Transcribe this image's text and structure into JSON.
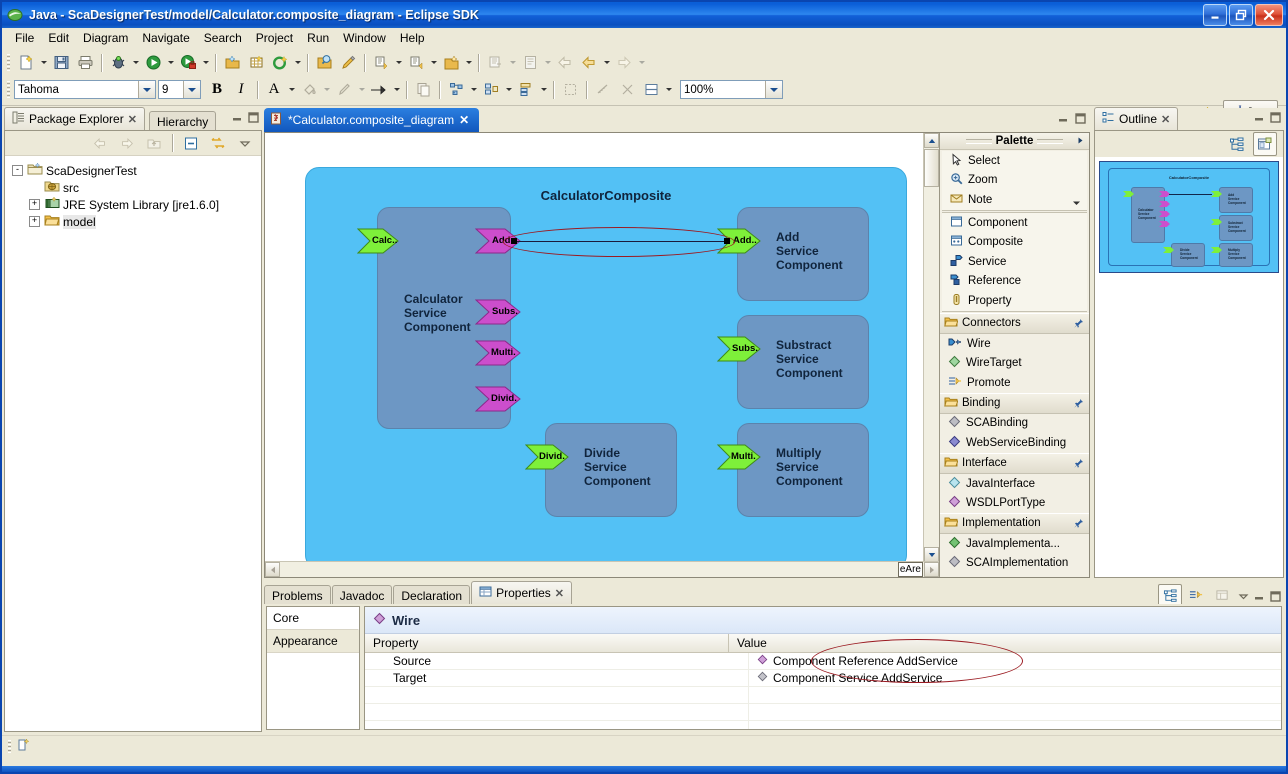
{
  "window": {
    "title": "Java - ScaDesignerTest/model/Calculator.composite_diagram - Eclipse SDK",
    "app_icon": "eclipse-icon",
    "minimize_label": "–",
    "restore_label": "❐",
    "close_label": "✕"
  },
  "menubar": {
    "items": [
      "File",
      "Edit",
      "Diagram",
      "Navigate",
      "Search",
      "Project",
      "Run",
      "Window",
      "Help"
    ]
  },
  "toolbar": {
    "font_family_value": "Tahoma",
    "font_size_value": "9",
    "bold_label": "B",
    "italic_label": "I",
    "font_color_label": "A",
    "zoom_value": "100%",
    "perspective_label": "Java",
    "perspective_icon": "java-perspective-icon",
    "open_perspective_icon": "open-perspective-icon"
  },
  "package_explorer": {
    "tab_label": "Package Explorer",
    "tab_icon": "package-explorer-icon",
    "close_label": "✕",
    "hierarchy_tab_label": "Hierarchy",
    "hierarchy_tab_icon": "hierarchy-icon",
    "toolbar": [
      "back-icon",
      "forward-icon",
      "up-icon",
      "collapse-all-icon",
      "link-with-editor-icon",
      "view-menu-icon"
    ],
    "minimize_label": "–",
    "maximize_label": "❐",
    "tree": [
      {
        "label": "ScaDesignerTest",
        "icon": "project-icon",
        "expander": "-",
        "indent": 0,
        "selected": false
      },
      {
        "label": "src",
        "icon": "source-folder-icon",
        "expander": "",
        "indent": 1,
        "selected": false
      },
      {
        "label": "JRE System Library [jre1.6.0]",
        "icon": "library-icon",
        "expander": "+",
        "indent": 1,
        "selected": false
      },
      {
        "label": "model",
        "icon": "folder-icon",
        "expander": "+",
        "indent": 1,
        "selected": true
      }
    ]
  },
  "editor": {
    "tab_label": "*Calculator.composite_diagram",
    "tab_icon": "diagram-file-icon",
    "close_label": "✕",
    "minimize_label": "–",
    "maximize_label": "❐",
    "hscroll_tip": "eAre"
  },
  "diagram": {
    "composite_title": "CalculatorComposite",
    "components": [
      {
        "id": "calculator",
        "label": "Calculator\nService\nComponent",
        "label_lines": [
          "Calculator",
          "Service",
          "Component"
        ],
        "services": [
          {
            "label": "Calc..",
            "kind": "service"
          }
        ],
        "references": [
          {
            "label": "Add..",
            "kind": "reference"
          },
          {
            "label": "Subs.",
            "kind": "reference"
          },
          {
            "label": "Multi.",
            "kind": "reference"
          },
          {
            "label": "Divid.",
            "kind": "reference"
          }
        ]
      },
      {
        "id": "add",
        "label_lines": [
          "Add",
          "Service",
          "Component"
        ],
        "services": [
          {
            "label": "Add..",
            "kind": "service"
          }
        ],
        "references": []
      },
      {
        "id": "substract",
        "label_lines": [
          "Substract",
          "Service",
          "Component"
        ],
        "services": [
          {
            "label": "Subs.",
            "kind": "service"
          }
        ],
        "references": []
      },
      {
        "id": "divide",
        "label_lines": [
          "Divide",
          "Service",
          "Component"
        ],
        "services": [
          {
            "label": "Divid.",
            "kind": "service"
          }
        ],
        "references": []
      },
      {
        "id": "multiply",
        "label_lines": [
          "Multiply",
          "Service",
          "Component"
        ],
        "services": [
          {
            "label": "Multi.",
            "kind": "service"
          }
        ],
        "references": []
      }
    ],
    "colors": {
      "composite_fill": "#53c1f5",
      "component_fill": "#6d97c4",
      "service_port": "#7ef03a",
      "reference_port": "#cc4ecc",
      "wire": "#1a1a3c",
      "annotation": "#9b1b22"
    }
  },
  "palette": {
    "title": "Palette",
    "expand_icon": "chevron-right-icon",
    "tools": [
      {
        "label": "Select",
        "icon": "cursor-icon"
      },
      {
        "label": "Zoom",
        "icon": "magnifier-icon"
      },
      {
        "label": "Note",
        "icon": "note-icon"
      }
    ],
    "note_menu_icon": "chevron-down-icon",
    "nodes": [
      {
        "label": "Component",
        "icon": "component-icon"
      },
      {
        "label": "Composite",
        "icon": "composite-icon"
      },
      {
        "label": "Service",
        "icon": "service-icon"
      },
      {
        "label": "Reference",
        "icon": "reference-icon"
      },
      {
        "label": "Property",
        "icon": "property-icon"
      }
    ],
    "groups": [
      {
        "title": "Connectors",
        "icon": "folder-open-icon",
        "pin_icon": "pin-icon",
        "items": [
          {
            "label": "Wire",
            "icon": "wire-icon"
          },
          {
            "label": "WireTarget",
            "icon": "diamond-green-icon"
          },
          {
            "label": "Promote",
            "icon": "promote-icon"
          }
        ]
      },
      {
        "title": "Binding",
        "icon": "folder-open-icon",
        "pin_icon": "pin-icon",
        "items": [
          {
            "label": "SCABinding",
            "icon": "diamond-grey-icon"
          },
          {
            "label": "WebServiceBinding",
            "icon": "diamond-blue-icon"
          }
        ]
      },
      {
        "title": "Interface",
        "icon": "folder-open-icon",
        "pin_icon": "pin-icon",
        "items": [
          {
            "label": "JavaInterface",
            "icon": "diamond-cyan-icon"
          },
          {
            "label": "WSDLPortType",
            "icon": "diamond-purple-icon"
          }
        ]
      },
      {
        "title": "Implementation",
        "icon": "folder-open-icon",
        "pin_icon": "pin-icon",
        "items": [
          {
            "label": "JavaImplementa...",
            "icon": "diamond-green-icon"
          },
          {
            "label": "SCAImplementation",
            "icon": "diamond-grey-icon"
          }
        ]
      }
    ]
  },
  "outline": {
    "tab_label": "Outline",
    "tab_icon": "outline-icon",
    "close_label": "✕",
    "minimize_label": "–",
    "maximize_label": "❐",
    "toolbar": [
      "tree-view-icon",
      "overview-view-icon"
    ]
  },
  "properties": {
    "tabs": [
      {
        "label": "Problems",
        "active": false,
        "icon": null
      },
      {
        "label": "Javadoc",
        "active": false,
        "icon": null
      },
      {
        "label": "Declaration",
        "active": false,
        "icon": null
      },
      {
        "label": "Properties",
        "active": true,
        "icon": "properties-icon"
      }
    ],
    "close_label": "✕",
    "minimize_label": "–",
    "maximize_label": "❐",
    "toolbar": [
      "pin-properties-icon",
      "show-advanced-icon",
      "restore-defaults-icon",
      "view-menu-icon"
    ],
    "side_tabs": [
      {
        "label": "Core",
        "selected": true
      },
      {
        "label": "Appearance",
        "selected": false
      }
    ],
    "section_title": "Wire",
    "section_icon": "wire-diamond-icon",
    "columns": [
      "Property",
      "Value"
    ],
    "rows": [
      {
        "property": "Source",
        "value": "Component Reference AddService",
        "icon": "diamond-purple-icon"
      },
      {
        "property": "Target",
        "value": "Component Service AddService",
        "icon": "diamond-grey-icon"
      }
    ]
  },
  "statusbar": {
    "icon": "selection-icon",
    "text": ""
  }
}
